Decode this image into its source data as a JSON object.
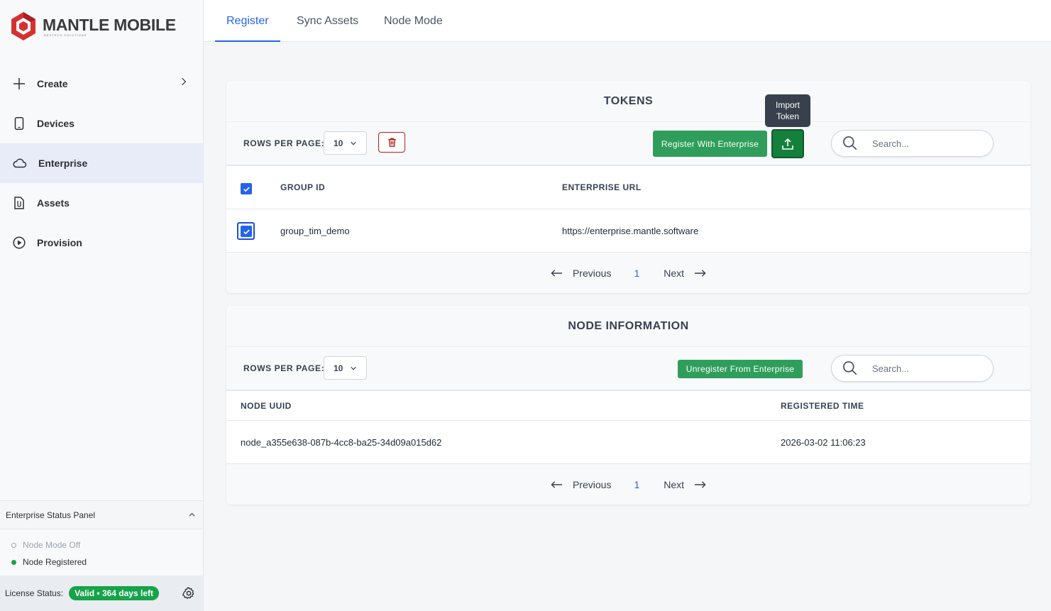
{
  "brand": {
    "title": "MANTLE MOBILE",
    "subtitle": "NEXTECH SOLUTIONS"
  },
  "colors": {
    "accent": "#2563eb",
    "active_nav_bg": "#e8ecf8",
    "success": "#16a34a",
    "button_green": "#2f9e5b",
    "danger": "#b91c1c"
  },
  "sidebar": {
    "items": [
      {
        "label": "Create",
        "icon": "plus-icon"
      },
      {
        "label": "Devices",
        "icon": "phone-icon"
      },
      {
        "label": "Enterprise",
        "icon": "cloud-icon",
        "active": true
      },
      {
        "label": "Assets",
        "icon": "file-icon"
      },
      {
        "label": "Provision",
        "icon": "play-circle-icon"
      }
    ],
    "status_panel": {
      "title": "Enterprise Status Panel",
      "node_mode": "Node Mode Off",
      "node_registered": "Node Registered"
    },
    "license": {
      "label": "License Status:",
      "badge": "Valid • 364 days left"
    }
  },
  "tabs": [
    {
      "label": "Register",
      "active": true
    },
    {
      "label": "Sync Assets"
    },
    {
      "label": "Node Mode"
    }
  ],
  "tokens": {
    "title": "TOKENS",
    "rows_per_page_label": "ROWS PER PAGE:",
    "rows_per_page": "10",
    "register_button": "Register With Enterprise",
    "tooltip": "Import Token",
    "search_placeholder": "Search...",
    "columns": [
      "GROUP ID",
      "ENTERPRISE URL"
    ],
    "rows": [
      {
        "group_id": "group_tim_demo",
        "enterprise_url": "https://enterprise.mantle.software",
        "checked": true
      }
    ],
    "pager": {
      "previous": "Previous",
      "page": "1",
      "next": "Next"
    }
  },
  "node_info": {
    "title": "NODE INFORMATION",
    "rows_per_page_label": "ROWS PER PAGE:",
    "rows_per_page": "10",
    "unregister_button": "Unregister From Enterprise",
    "search_placeholder": "Search...",
    "columns": [
      "NODE UUID",
      "REGISTERED TIME"
    ],
    "rows": [
      {
        "node_uuid": "node_a355e638-087b-4cc8-ba25-34d09a015d62",
        "registered_time": "2026-03-02 11:06:23"
      }
    ],
    "pager": {
      "previous": "Previous",
      "page": "1",
      "next": "Next"
    }
  }
}
